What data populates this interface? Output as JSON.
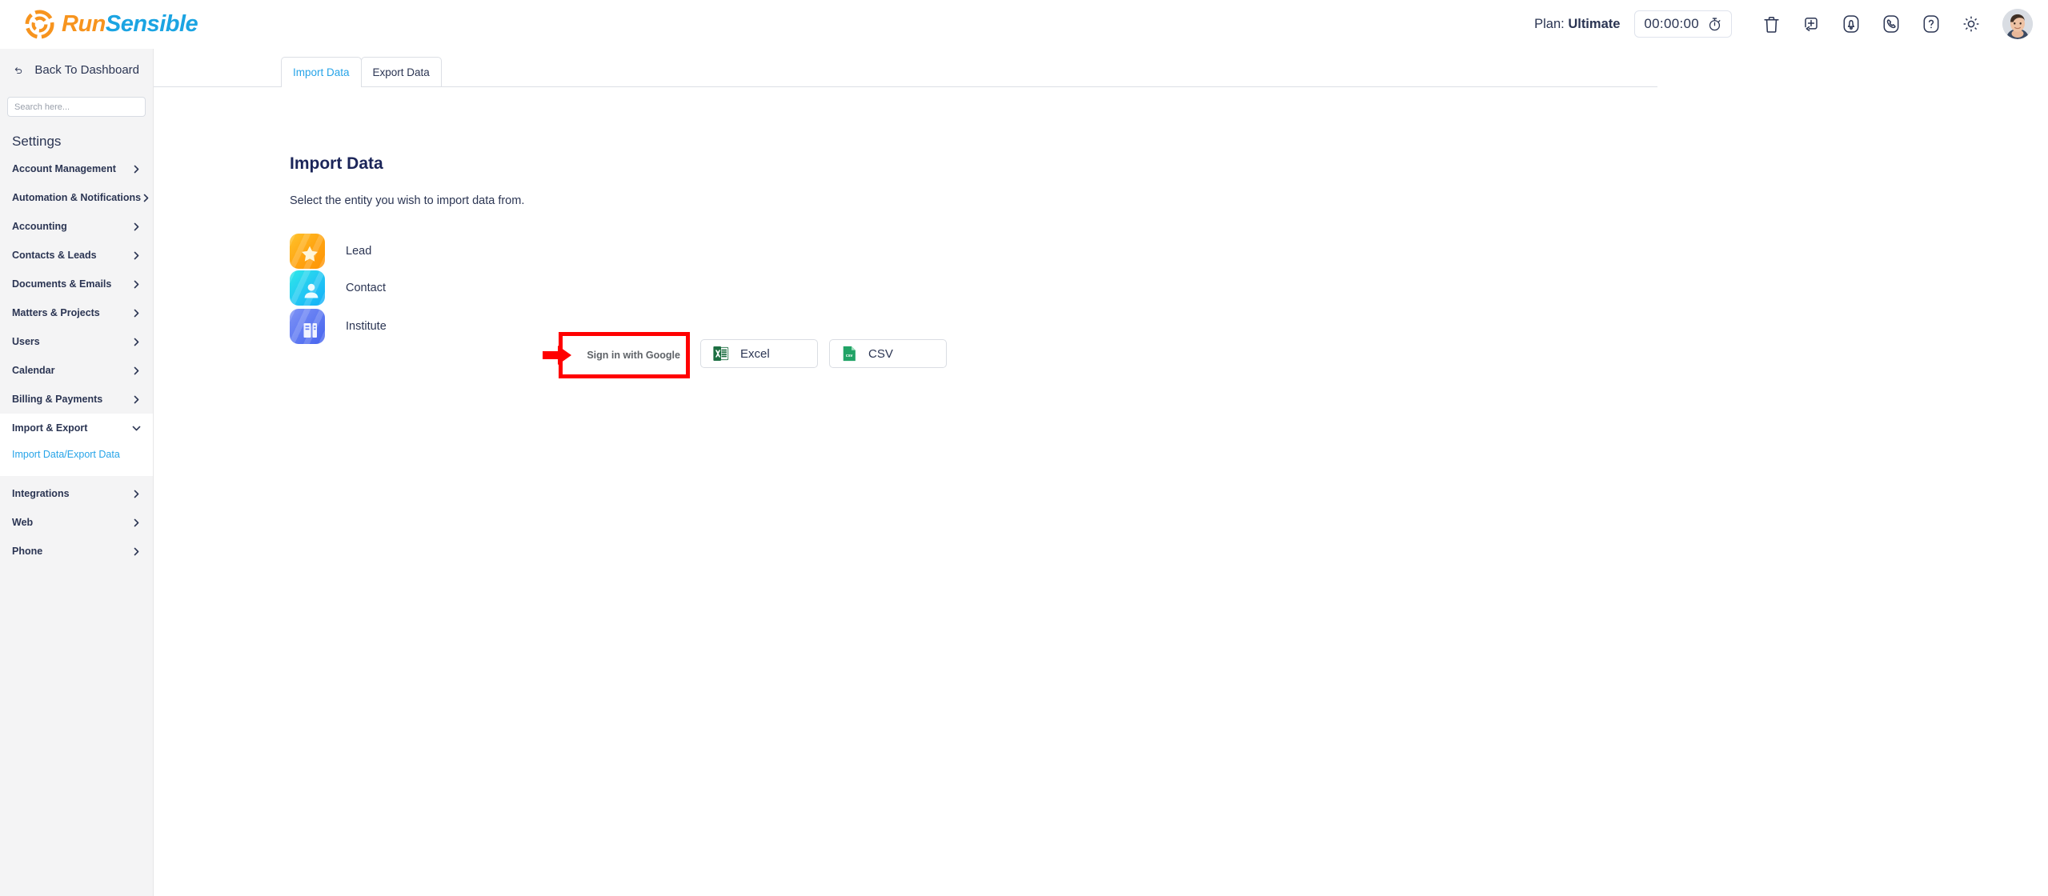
{
  "topbar": {
    "logo_run": "Run",
    "logo_sensible": "Sensible",
    "plan_prefix": "Plan:",
    "plan_value": "Ultimate",
    "timer_value": "00:00:00",
    "icons": [
      "stopwatch-icon",
      "trash-icon",
      "add-task-icon",
      "notification-bell-icon",
      "phone-icon",
      "help-icon",
      "settings-gear-icon",
      "user-avatar"
    ]
  },
  "sidebar": {
    "back_label": "Back To Dashboard",
    "search_placeholder": "Search here...",
    "search_value": "",
    "heading": "Settings",
    "items": [
      {
        "label": "Account Management",
        "expanded": false
      },
      {
        "label": "Automation & Notifications",
        "expanded": false
      },
      {
        "label": "Accounting",
        "expanded": false
      },
      {
        "label": "Contacts & Leads",
        "expanded": false
      },
      {
        "label": "Documents & Emails",
        "expanded": false
      },
      {
        "label": "Matters & Projects",
        "expanded": false
      },
      {
        "label": "Users",
        "expanded": false
      },
      {
        "label": "Calendar",
        "expanded": false
      },
      {
        "label": "Billing & Payments",
        "expanded": false
      },
      {
        "label": "Import & Export",
        "expanded": true
      },
      {
        "label": "Integrations",
        "expanded": false
      },
      {
        "label": "Web",
        "expanded": false
      },
      {
        "label": "Phone",
        "expanded": false
      }
    ],
    "sub_item": "Import Data/Export Data"
  },
  "tabs": [
    {
      "label": "Import Data",
      "active": true
    },
    {
      "label": "Export Data",
      "active": false
    }
  ],
  "main": {
    "title": "Import Data",
    "subtitle": "Select the entity you wish to import data from.",
    "entities": [
      {
        "label": "Lead",
        "icon": "star-icon"
      },
      {
        "label": "Contact",
        "icon": "person-icon"
      },
      {
        "label": "Institute",
        "icon": "building-icon"
      }
    ],
    "sources": {
      "google": "Sign in with Google",
      "excel": "Excel",
      "csv": "CSV",
      "csv_glyph": "csv"
    }
  },
  "colors": {
    "brand_orange": "#F7941E",
    "brand_blue": "#1BA4E2",
    "active_link": "#27A4E8",
    "text_dark": "#2b3553",
    "annotation_red": "#FF0000",
    "sidebar_bg": "#f4f4f5",
    "lead_icon": "#FFA310",
    "contact_icon": "#22C6F4",
    "institute_icon": "#5D78F2",
    "excel_green": "#1D6F42",
    "csv_green": "#21A366"
  }
}
